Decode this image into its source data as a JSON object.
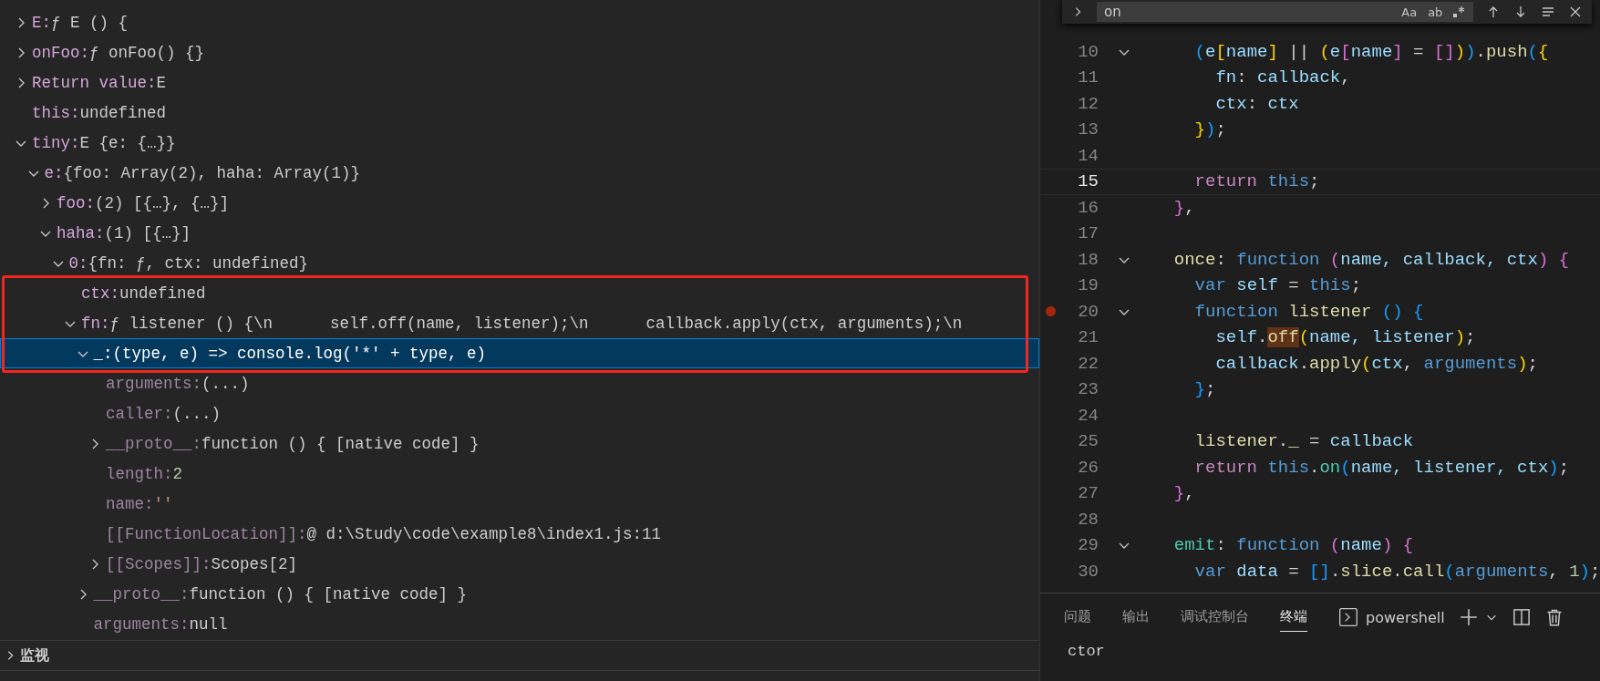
{
  "variables": [
    {
      "name": "E:",
      "value": "ƒ E () {",
      "kind": "plain",
      "dimmed": false,
      "selected": false,
      "expanded": false
    },
    {
      "name": "onFoo:",
      "value": "ƒ onFoo() {}",
      "kind": "plain",
      "dimmed": false,
      "selected": false,
      "expanded": false
    },
    {
      "name": "Return value:",
      "value": "E",
      "kind": "plain",
      "dimmed": false,
      "selected": false,
      "expanded": false
    },
    {
      "name": "this:",
      "value": "undefined",
      "kind": "plain",
      "dimmed": false,
      "selected": false
    },
    {
      "name": "tiny:",
      "value": "E {e: {…}}",
      "kind": "plain",
      "dimmed": false,
      "selected": false,
      "expanded": true,
      "children": [
        {
          "name": "e:",
          "value": "{foo: Array(2), haha: Array(1)}",
          "kind": "plain",
          "dimmed": false,
          "selected": false,
          "expanded": true,
          "children": [
            {
              "name": "foo:",
              "value": "(2) [{…}, {…}]",
              "kind": "plain",
              "dimmed": false,
              "selected": false,
              "expanded": false
            },
            {
              "name": "haha:",
              "value": "(1) [{…}]",
              "kind": "plain",
              "dimmed": false,
              "selected": false,
              "expanded": true,
              "children": [
                {
                  "name": "0:",
                  "value": "{fn: ƒ, ctx: undefined}",
                  "kind": "plain",
                  "dimmed": false,
                  "selected": false,
                  "expanded": true,
                  "children": [
                    {
                      "name": "ctx:",
                      "value": "undefined",
                      "kind": "plain",
                      "dimmed": false,
                      "selected": false,
                      "boxed": true
                    },
                    {
                      "name": "fn:",
                      "value": "ƒ listener () {\\n      self.off(name, listener);\\n      callback.apply(ctx, arguments);\\n",
                      "kind": "plain",
                      "dimmed": false,
                      "selected": false,
                      "boxed": true,
                      "expanded": true,
                      "children": [
                        {
                          "name": "_:",
                          "value": "(type, e) => console.log('*' + type, e)",
                          "kind": "plain",
                          "dimmed": false,
                          "selected": true,
                          "boxed": true,
                          "expanded": true,
                          "children": [
                            {
                              "name": "arguments:",
                              "value": "(...)",
                              "kind": "plain",
                              "dimmed": true,
                              "selected": false
                            },
                            {
                              "name": "caller:",
                              "value": "(...)",
                              "kind": "plain",
                              "dimmed": true,
                              "selected": false
                            },
                            {
                              "name": "__proto__:",
                              "value": "function () { [native code] }",
                              "kind": "plain",
                              "dimmed": true,
                              "selected": false,
                              "expanded": false
                            },
                            {
                              "name": "length:",
                              "value": "2",
                              "kind": "number",
                              "dimmed": true,
                              "selected": false
                            },
                            {
                              "name": "name:",
                              "value": "''",
                              "kind": "string",
                              "dimmed": true,
                              "selected": false
                            },
                            {
                              "name": "[[FunctionLocation]]:",
                              "value": "@ d:\\Study\\code\\example8\\index1.js:11",
                              "kind": "plain",
                              "dimmed": true,
                              "selected": false
                            },
                            {
                              "name": "[[Scopes]]:",
                              "value": "Scopes[2]",
                              "kind": "plain",
                              "dimmed": true,
                              "selected": false,
                              "expanded": false
                            }
                          ]
                        },
                        {
                          "name": "__proto__:",
                          "value": "function () { [native code] }",
                          "kind": "plain",
                          "dimmed": true,
                          "selected": false,
                          "expanded": false
                        },
                        {
                          "name": "arguments:",
                          "value": "null",
                          "kind": "plain",
                          "dimmed": true,
                          "selected": false
                        }
                      ]
                    }
                  ]
                }
              ]
            }
          ]
        }
      ]
    }
  ],
  "annotation": {
    "kind": "rectangle"
  },
  "sections": [
    {
      "title": "监视",
      "expanded": false
    }
  ],
  "find_widget": {
    "value": "on",
    "options": [
      "Aa",
      "ab"
    ]
  },
  "code_lines": [
    {
      "number": "10",
      "fold": true,
      "breakpoint": false,
      "current": false,
      "tokens": [
        {
          "kind": "b3",
          "text": "    ("
        },
        {
          "kind": "var",
          "text": "e"
        },
        {
          "kind": "b1",
          "text": "["
        },
        {
          "kind": "var",
          "text": "name"
        },
        {
          "kind": "b1",
          "text": "]"
        },
        {
          "kind": "p",
          "text": " || "
        },
        {
          "kind": "b1",
          "text": "("
        },
        {
          "kind": "var",
          "text": "e"
        },
        {
          "kind": "b2",
          "text": "["
        },
        {
          "kind": "var",
          "text": "name"
        },
        {
          "kind": "b2",
          "text": "]"
        },
        {
          "kind": "p",
          "text": " = "
        },
        {
          "kind": "b2",
          "text": "[]"
        },
        {
          "kind": "b1",
          "text": ")"
        },
        {
          "kind": "b3",
          "text": ")"
        },
        {
          "kind": "p",
          "text": "."
        },
        {
          "kind": "fn",
          "text": "push"
        },
        {
          "kind": "b3",
          "text": "("
        },
        {
          "kind": "b1",
          "text": "{"
        }
      ]
    },
    {
      "number": "11",
      "fold": false,
      "breakpoint": false,
      "current": false,
      "tokens": [
        {
          "kind": "var",
          "text": "      fn"
        },
        {
          "kind": "p",
          "text": ": "
        },
        {
          "kind": "var",
          "text": "callback"
        },
        {
          "kind": "p",
          "text": ","
        }
      ]
    },
    {
      "number": "12",
      "fold": false,
      "breakpoint": false,
      "current": false,
      "tokens": [
        {
          "kind": "var",
          "text": "      ctx"
        },
        {
          "kind": "p",
          "text": ": "
        },
        {
          "kind": "var",
          "text": "ctx"
        }
      ]
    },
    {
      "number": "13",
      "fold": false,
      "breakpoint": false,
      "current": false,
      "tokens": [
        {
          "kind": "b1",
          "text": "    }"
        },
        {
          "kind": "b3",
          "text": ")"
        },
        {
          "kind": "p",
          "text": ";"
        }
      ]
    },
    {
      "number": "14",
      "fold": false,
      "breakpoint": false,
      "current": false
    },
    {
      "number": "15",
      "fold": false,
      "breakpoint": false,
      "current": true,
      "tokens": [
        {
          "kind": "ctrl",
          "text": "    return"
        },
        {
          "kind": "kw",
          "text": " this"
        },
        {
          "kind": "p",
          "text": ";"
        }
      ]
    },
    {
      "number": "16",
      "fold": false,
      "breakpoint": false,
      "current": false,
      "tokens": [
        {
          "kind": "b2",
          "text": "  }"
        },
        {
          "kind": "p",
          "text": ","
        }
      ]
    },
    {
      "number": "17",
      "fold": false,
      "breakpoint": false,
      "current": false
    },
    {
      "number": "18",
      "fold": true,
      "breakpoint": false,
      "current": false,
      "tokens": [
        {
          "kind": "fn",
          "text": "  once"
        },
        {
          "kind": "p",
          "text": ": "
        },
        {
          "kind": "kw",
          "text": "function"
        },
        {
          "kind": "b2",
          "text": " ("
        },
        {
          "kind": "var",
          "text": "name, callback, ctx"
        },
        {
          "kind": "b2",
          "text": ")"
        },
        {
          "kind": "b2",
          "text": " {"
        }
      ]
    },
    {
      "number": "19",
      "fold": false,
      "breakpoint": false,
      "current": false,
      "tokens": [
        {
          "kind": "kw",
          "text": "    var"
        },
        {
          "kind": "var",
          "text": " self"
        },
        {
          "kind": "p",
          "text": " = "
        },
        {
          "kind": "kw",
          "text": "this"
        },
        {
          "kind": "p",
          "text": ";"
        }
      ]
    },
    {
      "number": "20",
      "fold": true,
      "breakpoint": true,
      "current": false,
      "tokens": [
        {
          "kind": "kw",
          "text": "    function"
        },
        {
          "kind": "fn",
          "text": " listener"
        },
        {
          "kind": "b3",
          "text": " ()"
        },
        {
          "kind": "b3",
          "text": " {"
        }
      ]
    },
    {
      "number": "21",
      "fold": false,
      "breakpoint": false,
      "current": false,
      "tokens": [
        {
          "kind": "var",
          "text": "      self"
        },
        {
          "kind": "p",
          "text": "."
        },
        {
          "kind": "fn",
          "text": "off",
          "match": true
        },
        {
          "kind": "b1",
          "text": "("
        },
        {
          "kind": "var",
          "text": "name, listener"
        },
        {
          "kind": "b1",
          "text": ")"
        },
        {
          "kind": "p",
          "text": ";"
        }
      ]
    },
    {
      "number": "22",
      "fold": false,
      "breakpoint": false,
      "current": false,
      "tokens": [
        {
          "kind": "var",
          "text": "      callback"
        },
        {
          "kind": "p",
          "text": "."
        },
        {
          "kind": "fn",
          "text": "apply"
        },
        {
          "kind": "b1",
          "text": "("
        },
        {
          "kind": "var",
          "text": "ctx"
        },
        {
          "kind": "p",
          "text": ", "
        },
        {
          "kind": "kw",
          "text": "arguments"
        },
        {
          "kind": "b1",
          "text": ")"
        },
        {
          "kind": "p",
          "text": ";"
        }
      ]
    },
    {
      "number": "23",
      "fold": false,
      "breakpoint": false,
      "current": false,
      "tokens": [
        {
          "kind": "b3",
          "text": "    }"
        },
        {
          "kind": "p",
          "text": ";"
        }
      ]
    },
    {
      "number": "24",
      "fold": false,
      "breakpoint": false,
      "current": false
    },
    {
      "number": "25",
      "fold": false,
      "breakpoint": false,
      "current": false,
      "tokens": [
        {
          "kind": "fn",
          "text": "    listener"
        },
        {
          "kind": "p",
          "text": "."
        },
        {
          "kind": "fn",
          "text": "_"
        },
        {
          "kind": "p",
          "text": " = "
        },
        {
          "kind": "var",
          "text": "callback"
        }
      ]
    },
    {
      "number": "26",
      "fold": false,
      "breakpoint": false,
      "current": false,
      "tokens": [
        {
          "kind": "ctrl",
          "text": "    return"
        },
        {
          "kind": "kw",
          "text": " this"
        },
        {
          "kind": "p",
          "text": "."
        },
        {
          "kind": "cls",
          "text": "on"
        },
        {
          "kind": "b3",
          "text": "("
        },
        {
          "kind": "var",
          "text": "name, listener, ctx"
        },
        {
          "kind": "b3",
          "text": ")"
        },
        {
          "kind": "p",
          "text": ";"
        }
      ]
    },
    {
      "number": "27",
      "fold": false,
      "breakpoint": false,
      "current": false,
      "tokens": [
        {
          "kind": "b2",
          "text": "  }"
        },
        {
          "kind": "p",
          "text": ","
        }
      ]
    },
    {
      "number": "28",
      "fold": false,
      "breakpoint": false,
      "current": false
    },
    {
      "number": "29",
      "fold": true,
      "breakpoint": false,
      "current": false,
      "tokens": [
        {
          "kind": "cls",
          "text": "  emit"
        },
        {
          "kind": "p",
          "text": ": "
        },
        {
          "kind": "kw",
          "text": "function"
        },
        {
          "kind": "b2",
          "text": " ("
        },
        {
          "kind": "var",
          "text": "name"
        },
        {
          "kind": "b2",
          "text": ")"
        },
        {
          "kind": "b2",
          "text": " {"
        }
      ]
    },
    {
      "number": "30",
      "fold": false,
      "breakpoint": false,
      "current": false,
      "tokens": [
        {
          "kind": "kw",
          "text": "    var"
        },
        {
          "kind": "var",
          "text": " data"
        },
        {
          "kind": "p",
          "text": " = "
        },
        {
          "kind": "b3",
          "text": "[]"
        },
        {
          "kind": "p",
          "text": "."
        },
        {
          "kind": "fn",
          "text": "slice"
        },
        {
          "kind": "p",
          "text": "."
        },
        {
          "kind": "fn",
          "text": "call"
        },
        {
          "kind": "b3",
          "text": "("
        },
        {
          "kind": "kw",
          "text": "arguments"
        },
        {
          "kind": "p",
          "text": ", "
        },
        {
          "kind": "num",
          "text": "1"
        },
        {
          "kind": "b3",
          "text": ")"
        },
        {
          "kind": "p",
          "text": ";"
        }
      ]
    }
  ],
  "panel": {
    "tabs": [
      {
        "label": "问题",
        "selected": false
      },
      {
        "label": "输出",
        "selected": false
      },
      {
        "label": "调试控制台",
        "selected": false
      },
      {
        "label": "终端",
        "selected": true
      }
    ],
    "terminal_profile": "powershell",
    "terminal_lines": [
      "ctor"
    ]
  }
}
